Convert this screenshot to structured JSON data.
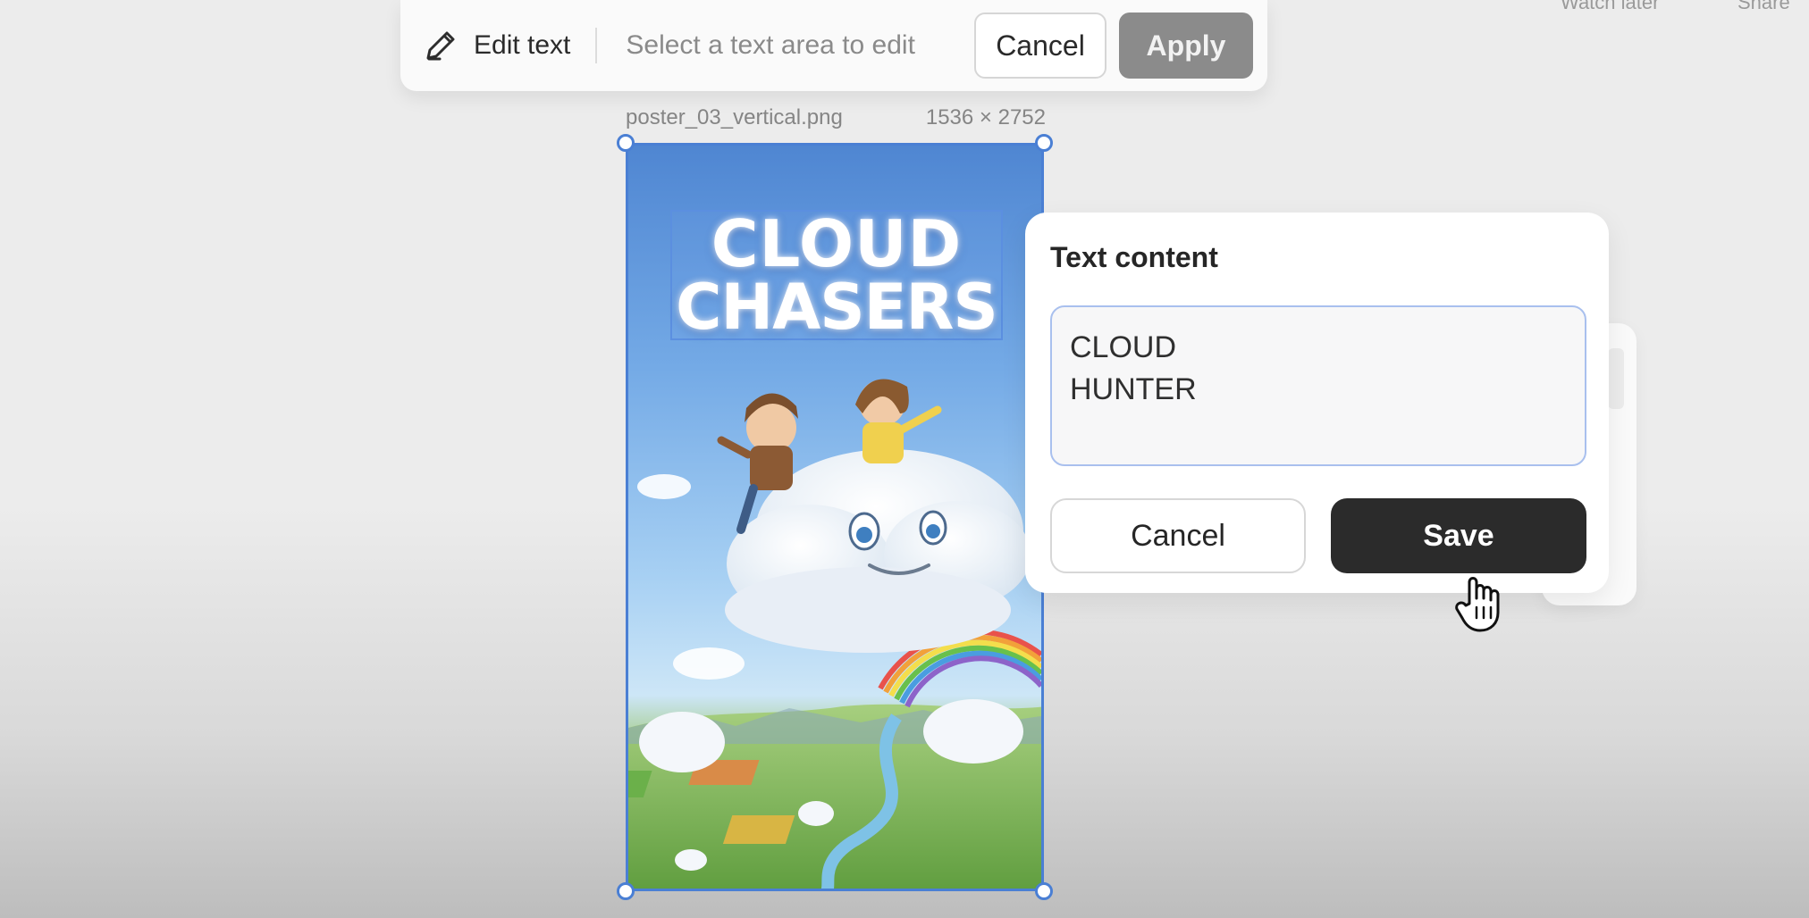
{
  "header": {
    "watch_later": "Watch later",
    "share": "Share"
  },
  "toolbar": {
    "edit_icon": "pencil-icon",
    "edit_label": "Edit text",
    "hint": "Select a text area to edit",
    "cancel_label": "Cancel",
    "apply_label": "Apply"
  },
  "file": {
    "name": "poster_03_vertical.png",
    "dimensions": "1536 × 2752"
  },
  "poster": {
    "title_line1": "CLOUD",
    "title_line2": "CHASERS"
  },
  "dialog": {
    "title": "Text content",
    "text_value": "CLOUD\nHUNTER",
    "cancel_label": "Cancel",
    "save_label": "Save"
  },
  "cursor": {
    "icon": "hand-pointer-icon"
  },
  "colors": {
    "selection": "#4a7fd4",
    "save_button": "#2b2b2b",
    "apply_button": "#8b8b8b",
    "background": "#ececec"
  }
}
